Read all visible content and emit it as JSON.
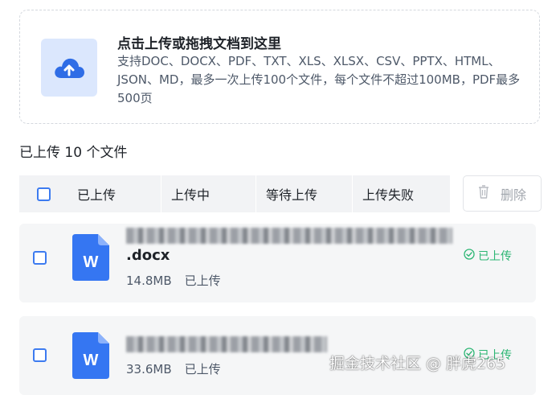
{
  "upload": {
    "title": "点击上传或拖拽文档到这里",
    "description": "支持DOC、DOCX、PDF、TXT、XLS、XLSX、CSV、PPTX、HTML、JSON、MD，最多一次上传100个文件，每个文件不超过100MB，PDF最多500页",
    "icon": "cloud-upload-icon"
  },
  "list": {
    "count_label": "已上传 10 个文件"
  },
  "tabs": [
    {
      "label": "已上传"
    },
    {
      "label": "上传中"
    },
    {
      "label": "等待上传"
    },
    {
      "label": "上传失败"
    }
  ],
  "delete_button": {
    "label": "删除",
    "icon": "trash-icon"
  },
  "files": [
    {
      "name_ext": ".docx",
      "size": "14.8MB",
      "status_text": "已上传",
      "badge": "已上传",
      "icon": "word-doc-icon"
    },
    {
      "name_ext": "",
      "size": "33.6MB",
      "status_text": "已上传",
      "badge": "已上传",
      "icon": "word-doc-icon"
    }
  ],
  "watermark": "掘金技术社区 @ 胖虎265",
  "colors": {
    "accent": "#3d7bf0",
    "success": "#2bb673",
    "upload_icon_bg": "#dbe7fd"
  }
}
